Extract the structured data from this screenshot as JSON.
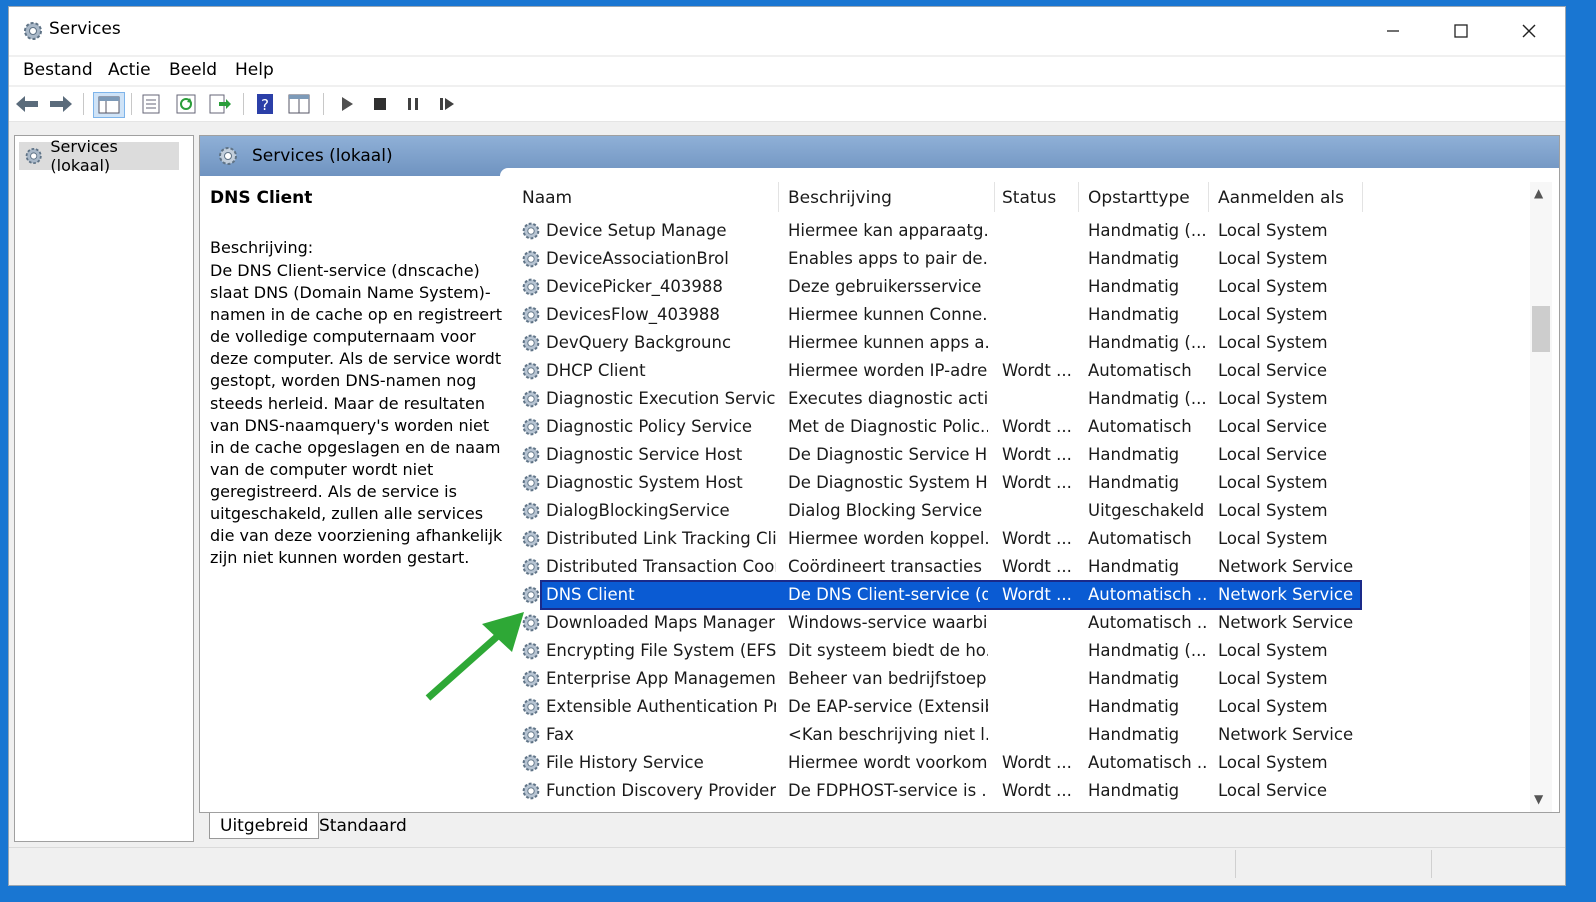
{
  "window": {
    "title": "Services"
  },
  "menu": {
    "items": [
      "Bestand",
      "Actie",
      "Beeld",
      "Help"
    ]
  },
  "tree": {
    "root_label": "Services (lokaal)"
  },
  "main": {
    "header_title": "Services (lokaal)",
    "selected_service_title": "DNS Client",
    "description_label": "Beschrijving:",
    "description_text": "De DNS Client-service (dnscache) slaat DNS (Domain Name System)-namen in de cache op en registreert de volledige computernaam voor deze computer. Als de service wordt gestopt, worden DNS-namen nog steeds herleid. Maar de resultaten van DNS-naamquery's worden niet in de cache opgeslagen en de naam van de computer wordt niet geregistreerd. Als de service is uitgeschakeld, zullen alle services die van deze voorziening afhankelijk zijn niet kunnen worden gestart."
  },
  "table": {
    "columns": [
      "Naam",
      "Beschrijving",
      "Status",
      "Opstarttype",
      "Aanmelden als"
    ],
    "rows": [
      [
        "Device Setup Manage",
        "Hiermee kan apparaatg...",
        "",
        "Handmatig (...",
        "Local System"
      ],
      [
        "DeviceAssociationBrol",
        "Enables apps to pair de...",
        "",
        "Handmatig",
        "Local System"
      ],
      [
        "DevicePicker_403988",
        "Deze gebruikersservice ...",
        "",
        "Handmatig",
        "Local System"
      ],
      [
        "DevicesFlow_403988",
        "Hiermee kunnen Conne...",
        "",
        "Handmatig",
        "Local System"
      ],
      [
        "DevQuery Backgrounc",
        "Hiermee kunnen apps a...",
        "",
        "Handmatig (...",
        "Local System"
      ],
      [
        "DHCP Client",
        "Hiermee worden IP-adre...",
        "Wordt ...",
        "Automatisch",
        "Local Service"
      ],
      [
        "Diagnostic Execution Service",
        "Executes diagnostic acti...",
        "",
        "Handmatig (...",
        "Local System"
      ],
      [
        "Diagnostic Policy Service",
        "Met de Diagnostic Polic...",
        "Wordt ...",
        "Automatisch",
        "Local Service"
      ],
      [
        "Diagnostic Service Host",
        "De Diagnostic Service H...",
        "Wordt ...",
        "Handmatig",
        "Local Service"
      ],
      [
        "Diagnostic System Host",
        "De Diagnostic System H...",
        "Wordt ...",
        "Handmatig",
        "Local System"
      ],
      [
        "DialogBlockingService",
        "Dialog Blocking Service",
        "",
        "Uitgeschakeld",
        "Local System"
      ],
      [
        "Distributed Link Tracking Cli...",
        "Hiermee worden koppel...",
        "Wordt ...",
        "Automatisch",
        "Local System"
      ],
      [
        "Distributed Transaction Coor...",
        "Coördineert transacties ...",
        "Wordt ...",
        "Handmatig",
        "Network Service"
      ],
      [
        "DNS Client",
        "De DNS Client-service (d...",
        "Wordt ...",
        "Automatisch ...",
        "Network Service"
      ],
      [
        "Downloaded Maps Manager",
        "Windows-service waarbi...",
        "",
        "Automatisch ...",
        "Network Service"
      ],
      [
        "Encrypting File System (EFS)",
        "Dit systeem biedt de ho...",
        "",
        "Handmatig (...",
        "Local System"
      ],
      [
        "Enterprise App Managemen...",
        "Beheer van bedrijfstoep...",
        "",
        "Handmatig",
        "Local System"
      ],
      [
        "Extensible Authentication Pr...",
        "De EAP-service (Extensib...",
        "",
        "Handmatig",
        "Local System"
      ],
      [
        "Fax",
        "<Kan beschrijving niet l...",
        "",
        "Handmatig",
        "Network Service"
      ],
      [
        "File History Service",
        "Hiermee wordt voorkom...",
        "Wordt ...",
        "Automatisch ...",
        "Local System"
      ],
      [
        "Function Discovery Provider ...",
        "De FDPHOST-service is ...",
        "Wordt ...",
        "Handmatig",
        "Local Service"
      ]
    ],
    "selected_row": "DNS Client"
  },
  "tabs": [
    "Uitgebreid",
    "Standaard"
  ],
  "colors": {
    "selection": "#0a5bd3",
    "header_blue": "#7fa3cf",
    "desktop": "#1976d2",
    "annotation_arrow": "#2ea836"
  },
  "icons": [
    "services-gear-icon",
    "back-arrow-icon",
    "forward-arrow-icon",
    "show-tree-icon",
    "properties-icon",
    "refresh-icon",
    "export-icon",
    "help-icon",
    "console-icon",
    "play-icon",
    "stop-icon",
    "pause-icon",
    "resume-icon",
    "minimize-icon",
    "maximize-icon",
    "close-icon"
  ]
}
